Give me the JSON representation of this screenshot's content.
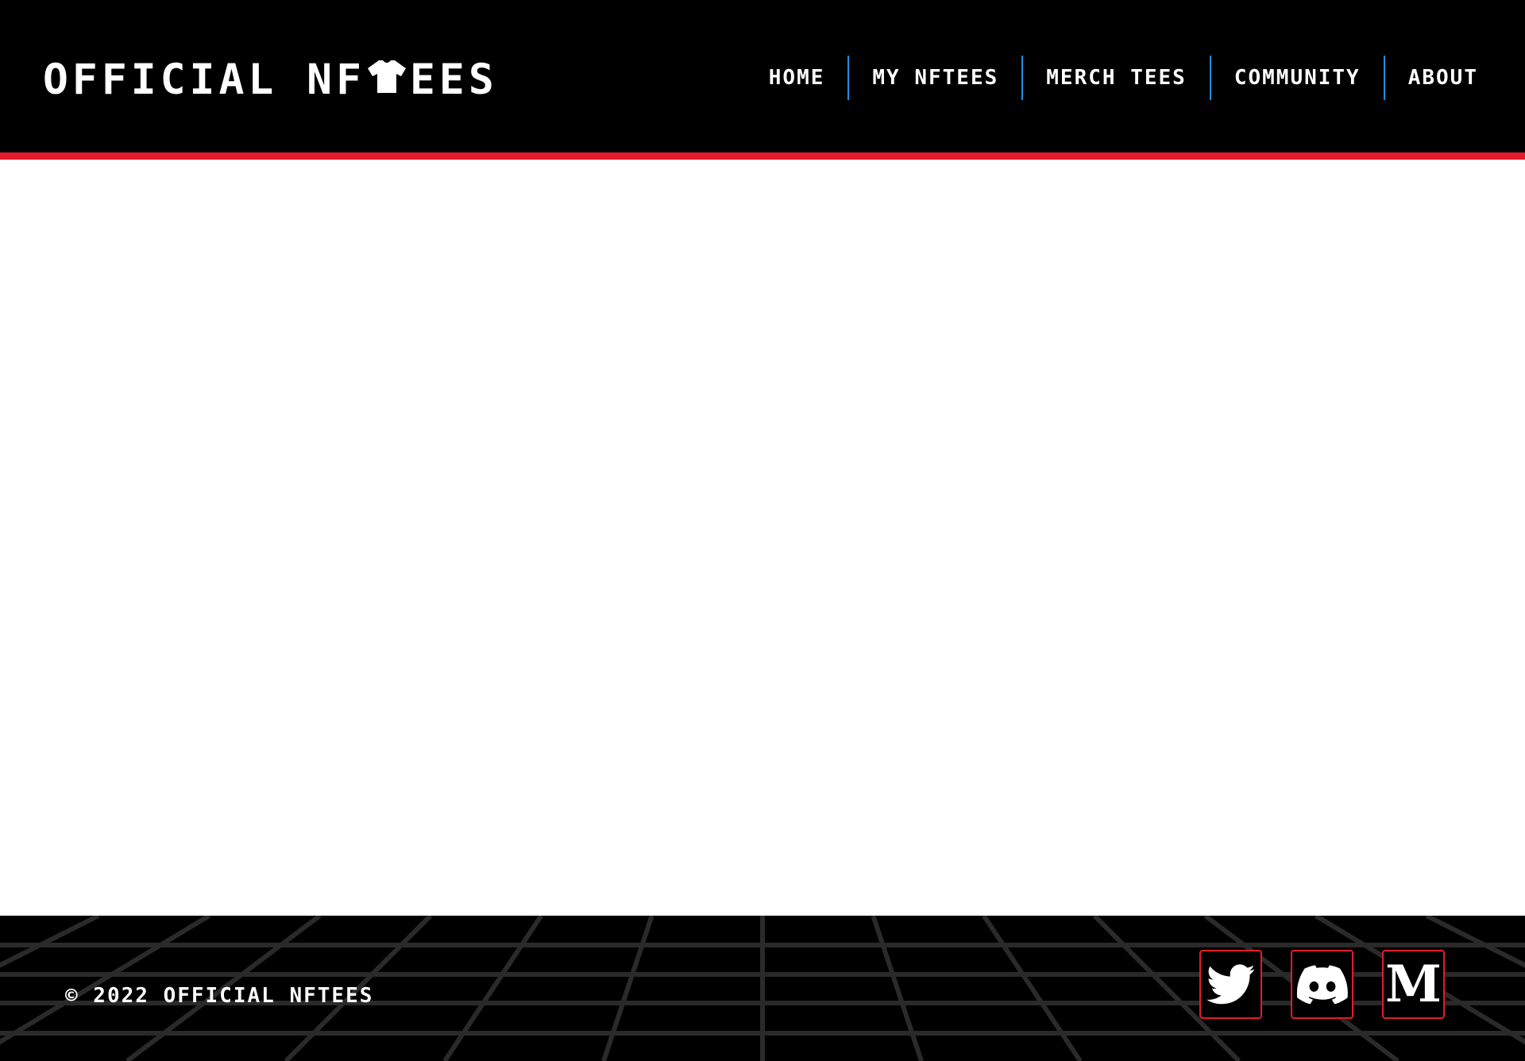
{
  "header": {
    "logo_part1": "OFFICIAL NF",
    "logo_icon": "tshirt-icon",
    "logo_part2": "EES",
    "nav": [
      {
        "label": "HOME"
      },
      {
        "label": "MY NFTEES"
      },
      {
        "label": "MERCH TEES"
      },
      {
        "label": "COMMUNITY"
      },
      {
        "label": "ABOUT"
      }
    ]
  },
  "footer": {
    "copyright": "© 2022 OFFICIAL NFTEES",
    "socials": [
      {
        "icon": "twitter-icon"
      },
      {
        "icon": "discord-icon"
      },
      {
        "icon": "medium-icon",
        "glyph": "M"
      }
    ]
  },
  "colors": {
    "background": "#000000",
    "accent_red": "#e31b2b",
    "nav_divider_blue": "#1f8fe0",
    "text": "#ffffff",
    "grid_lines": "#2a2a2a"
  }
}
